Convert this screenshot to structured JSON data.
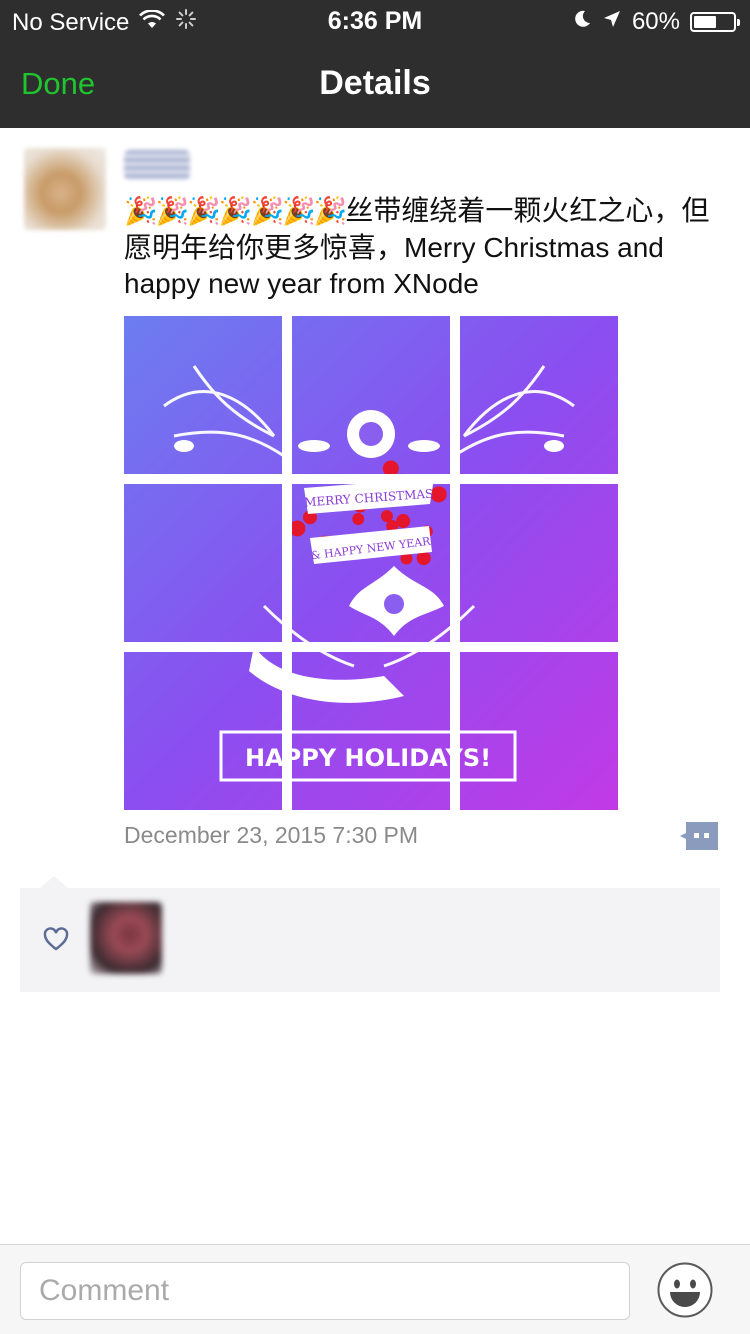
{
  "status_bar": {
    "carrier": "No Service",
    "time": "6:36 PM",
    "battery_percent": "60%",
    "battery_level": 0.6,
    "icons": [
      "wifi-icon",
      "loading-spinner-icon",
      "moon-icon",
      "location-arrow-icon",
      "battery-icon"
    ]
  },
  "nav": {
    "done_label": "Done",
    "title": "Details"
  },
  "post": {
    "emoji": "🎉🎉🎉🎉🎉🎉🎉",
    "text": "丝带缠绕着一颗火红之心，但愿明年给你更多惊喜，Merry Christmas and happy new year from XNode",
    "image_text": {
      "ribbon_line1": "MERRY CHRISTMAS",
      "ribbon_line2": "& HAPPY NEW YEAR",
      "banner": "HAPPY HOLIDAYS!"
    },
    "timestamp": "December 23, 2015 7:30 PM",
    "accent_color": "#1fc52f"
  },
  "likes": {
    "icon": "heart-icon"
  },
  "comment_bar": {
    "placeholder": "Comment",
    "emoji_button_icon": "smiley-icon"
  }
}
